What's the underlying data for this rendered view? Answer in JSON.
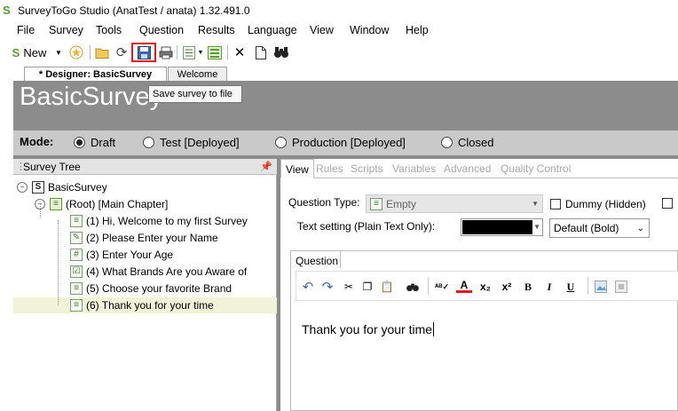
{
  "window": {
    "title": "SurveyToGo Studio (AnatTest / anata) 1.32.491.0",
    "icon": "app-logo-icon"
  },
  "menu": [
    "File",
    "Survey",
    "Tools",
    "Question",
    "Results",
    "Language",
    "View",
    "Window",
    "Help"
  ],
  "toolbar": {
    "new_label": "New",
    "tooltip": "Save survey to file",
    "highlight_color": "#e11b22"
  },
  "doc_tabs": [
    {
      "label": "* Designer: BasicSurvey",
      "active": true
    },
    {
      "label": "Welcome",
      "active": false
    }
  ],
  "designer": {
    "survey_title": "BasicSurvey",
    "mode_label": "Mode:",
    "modes": [
      {
        "label": "Draft",
        "selected": true
      },
      {
        "label": "Test [Deployed]",
        "selected": false
      },
      {
        "label": "Production [Deployed]",
        "selected": false
      },
      {
        "label": "Closed",
        "selected": false
      }
    ]
  },
  "tree": {
    "title": "Survey Tree",
    "root": "BasicSurvey",
    "chapter": "(Root) [Main Chapter]",
    "items": [
      "(1) Hi, Welcome to my first Survey",
      "(2) Please Enter your Name",
      "(3) Enter Your Age",
      "(4) What Brands Are you Aware of",
      "(5) Choose your favorite Brand",
      "(6) Thank you for your time"
    ],
    "selected_index": 5
  },
  "question_tabs": [
    "View",
    "Rules",
    "Scripts",
    "Variables",
    "Advanced",
    "Quality Control"
  ],
  "question": {
    "type_label": "Question Type:",
    "type_value": "Empty",
    "dummy_label": "Dummy (Hidden)",
    "text_setting_label": "Text setting (Plain Text Only):",
    "text_color": "#000000",
    "font_value": "Default (Bold)",
    "editor_tab": "Question",
    "editor_text": "Thank you for your time"
  },
  "colors": {
    "designer_bg": "#8c8c8c",
    "mode_bar": "#c9c9c9",
    "tree_selection": "#f0f3d8"
  }
}
